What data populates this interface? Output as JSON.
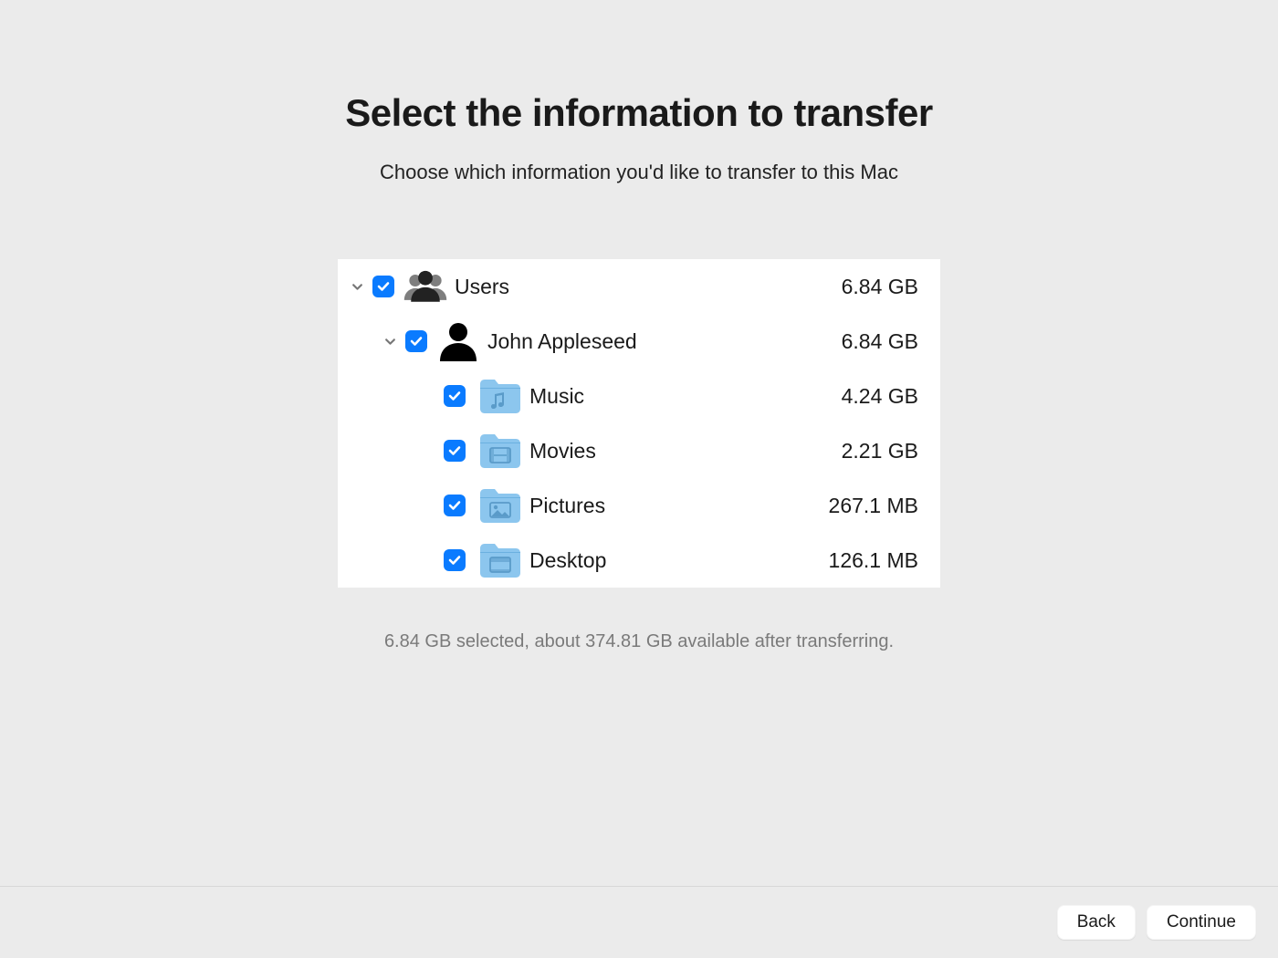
{
  "header": {
    "title": "Select the information to transfer",
    "subtitle": "Choose which information you'd like to transfer to this Mac"
  },
  "tree": {
    "users": {
      "label": "Users",
      "size": "6.84 GB",
      "checked": true,
      "expanded": true,
      "icon": "users-group-icon"
    },
    "user": {
      "label": "John Appleseed",
      "size": "6.84 GB",
      "checked": true,
      "expanded": true,
      "icon": "person-icon"
    },
    "items": [
      {
        "label": "Music",
        "size": "4.24 GB",
        "checked": true,
        "icon": "music-folder-icon"
      },
      {
        "label": "Movies",
        "size": "2.21 GB",
        "checked": true,
        "icon": "movies-folder-icon"
      },
      {
        "label": "Pictures",
        "size": "267.1 MB",
        "checked": true,
        "icon": "pictures-folder-icon"
      },
      {
        "label": "Desktop",
        "size": "126.1 MB",
        "checked": true,
        "icon": "desktop-folder-icon"
      }
    ]
  },
  "status": "6.84 GB selected, about 374.81 GB available after transferring.",
  "buttons": {
    "back": "Back",
    "continue": "Continue"
  },
  "colors": {
    "accent": "#0a7bff",
    "folder": "#8cc6ee",
    "folderDark": "#6bb0e0"
  }
}
